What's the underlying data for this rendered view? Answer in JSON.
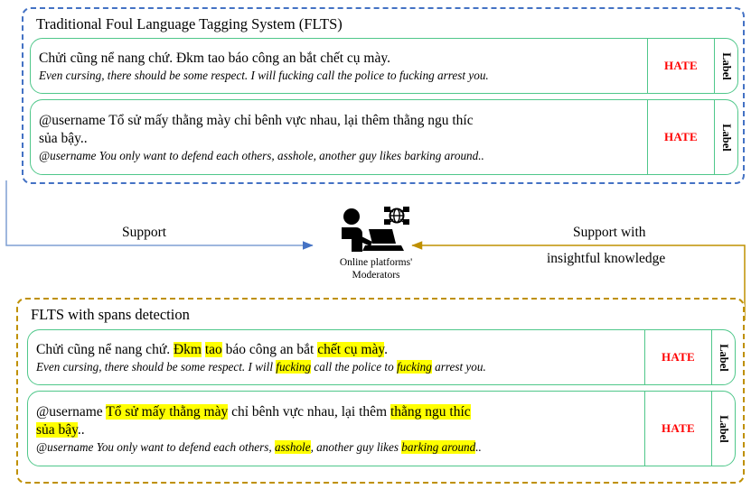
{
  "panels": {
    "top": {
      "title": "Traditional Foul Language Tagging System (FLTS)",
      "border_color": "#4472C4",
      "rows": [
        {
          "vi": "Chửi cũng nể nang chứ. Đkm tao báo công an bắt chết cụ mày.",
          "en": "Even cursing, there should be some respect. I will fucking call the police to fucking arrest you.",
          "label": "HATE",
          "side_label": "Label"
        },
        {
          "vi_line1": "@username Tổ sử mấy thằng mày chỉ bênh vực nhau, lại thêm thằng ngu thíc",
          "vi_line2": "sủa bậy..",
          "en": "@username You only want to defend each others, asshole, another guy likes barking around..",
          "label": "HATE",
          "side_label": "Label"
        }
      ]
    },
    "bottom": {
      "title": "FLTS with spans detection",
      "border_color": "#BF9000",
      "highlight_color": "#FFFF00",
      "rows": [
        {
          "vi_segments": [
            {
              "text": "Chửi cũng nể nang chứ. ",
              "highlight": false
            },
            {
              "text": "Đkm",
              "highlight": true
            },
            {
              "text": " ",
              "highlight": false
            },
            {
              "text": "tao",
              "highlight": true
            },
            {
              "text": " báo công an bắt ",
              "highlight": false
            },
            {
              "text": "chết cụ mày",
              "highlight": true
            },
            {
              "text": ".",
              "highlight": false
            }
          ],
          "en_segments": [
            {
              "text": "Even cursing, there should be some respect. I will ",
              "highlight": false
            },
            {
              "text": "fucking",
              "highlight": true
            },
            {
              "text": " call the police to ",
              "highlight": false
            },
            {
              "text": "fucking",
              "highlight": true
            },
            {
              "text": " arrest you.",
              "highlight": false
            }
          ],
          "label": "HATE",
          "side_label": "Label"
        },
        {
          "vi_segments": [
            {
              "text": "@username ",
              "highlight": false
            },
            {
              "text": "Tổ sử mấy thằng mày",
              "highlight": true
            },
            {
              "text": " chỉ bênh vực nhau, lại thêm ",
              "highlight": false
            },
            {
              "text": "thằng ngu thíc",
              "highlight": true
            }
          ],
          "vi_segments_line2": [
            {
              "text": "sủa bậy",
              "highlight": true
            },
            {
              "text": "..",
              "highlight": false
            }
          ],
          "en_segments": [
            {
              "text": "@username You only want to defend each others, ",
              "highlight": false
            },
            {
              "text": "asshole",
              "highlight": true
            },
            {
              "text": ", another guy likes ",
              "highlight": false
            },
            {
              "text": "barking around",
              "highlight": true
            },
            {
              "text": "..",
              "highlight": false
            }
          ],
          "label": "HATE",
          "side_label": "Label"
        }
      ]
    }
  },
  "flow": {
    "left_arrow": {
      "label": "Support",
      "color": "#4472C4",
      "direction": "right"
    },
    "right_arrow": {
      "label_line1": "Support with",
      "label_line2": "insightful knowledge",
      "color": "#BF9000",
      "direction": "left"
    }
  },
  "moderator": {
    "icon": "person-at-laptop-network-icon",
    "caption_line1": "Online platforms'",
    "caption_line2": "Moderators"
  }
}
